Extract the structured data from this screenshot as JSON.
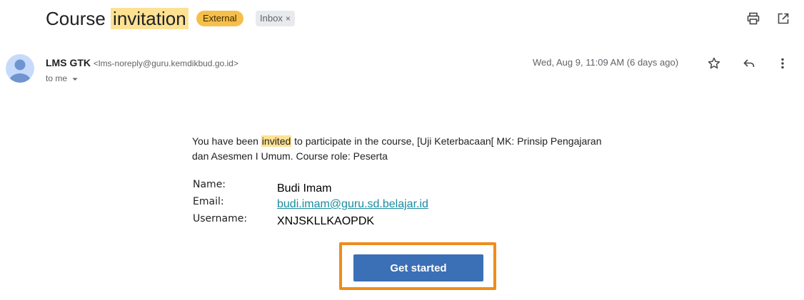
{
  "email": {
    "subject_pre": "Course ",
    "subject_highlight": "invitation",
    "labels": {
      "external": "External",
      "inbox": "Inbox",
      "inbox_close": "×"
    },
    "sender_name": "LMS GTK",
    "sender_address": "<lms-noreply@guru.kemdikbud.go.id>",
    "recipient": "to me",
    "date": "Wed, Aug 9, 11:09 AM (6 days ago)"
  },
  "body": {
    "intro_pre": "You have been ",
    "intro_highlight": "invited",
    "intro_post": " to participate in the course, [Uji Keterbacaan[ MK: Prinsip Pengajaran dan Asesmen I Umum. Course role: Peserta",
    "fields": [
      {
        "label": "Name:",
        "value": "Budi Imam"
      },
      {
        "label": "Email:",
        "value": "budi.imam@guru.sd.belajar.id"
      },
      {
        "label": "Username:",
        "value": "XNJSKLLKAOPDK"
      }
    ],
    "cta_label": "Get started"
  },
  "colors": {
    "highlight": "#fde293",
    "external_badge": "#f6bf4b",
    "cta": "#3b6fb6",
    "focus_outline": "#ef8c1c"
  },
  "icons": [
    "print-icon",
    "open-in-new-window-icon",
    "star-icon",
    "reply-icon",
    "more-vert-icon",
    "chevron-down-icon",
    "person-icon"
  ]
}
